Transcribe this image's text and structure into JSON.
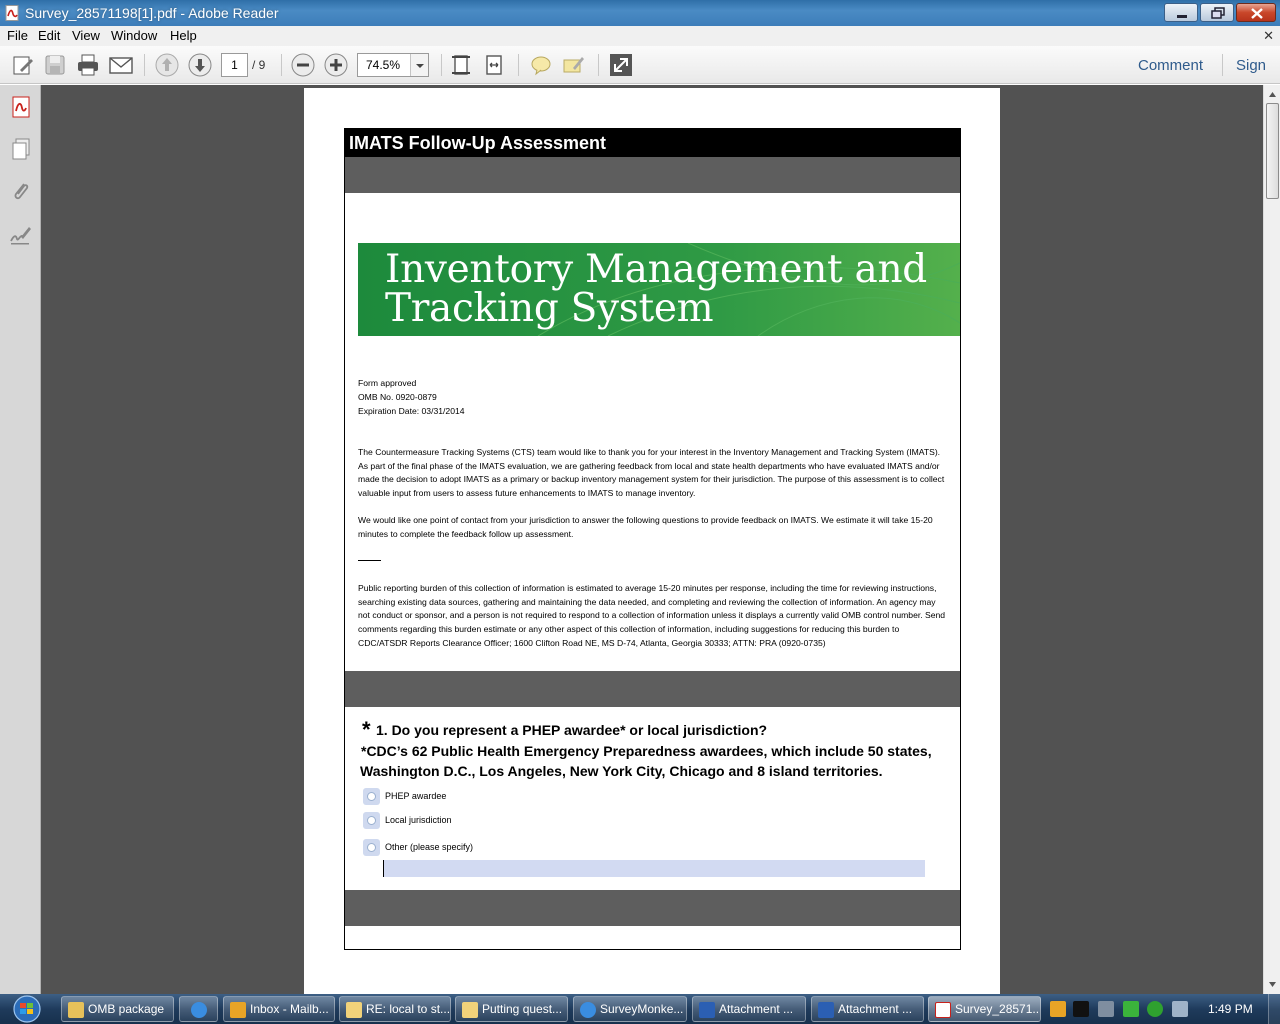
{
  "window": {
    "title": "Survey_28571198[1].pdf - Adobe Reader",
    "menu": [
      "File",
      "Edit",
      "View",
      "Window",
      "Help"
    ]
  },
  "toolbar": {
    "page_current": "1",
    "page_total": "/ 9",
    "zoom": "74.5%",
    "comment_label": "Comment",
    "sign_label": "Sign"
  },
  "document": {
    "form_title": "IMATS Follow-Up Assessment",
    "banner_line1": "Inventory Management and",
    "banner_line2": "Tracking System",
    "meta": [
      "Form approved",
      "OMB No. 0920-0879",
      "Expiration Date: 03/31/2014"
    ],
    "intro_p1": "The Countermeasure Tracking Systems (CTS) team would like to thank you for your interest in the Inventory Management and Tracking System (IMATS). As part of the final phase of the IMATS evaluation, we are gathering feedback from local and state health departments who have evaluated IMATS and/or made the decision to adopt IMATS as a primary or backup inventory management system for their jurisdiction. The purpose of this assessment is to collect valuable input from users to assess future enhancements to IMATS to manage inventory.",
    "intro_p2": "We would like one point of contact from your jurisdiction to answer the following questions to provide feedback on IMATS. We estimate it will take 15-20 minutes to complete the feedback follow up assessment.",
    "burden": "Public reporting burden of this collection of information is estimated to average 15-20 minutes per response, including the time for reviewing instructions, searching existing data sources, gathering and maintaining the data needed, and completing and reviewing the collection of information. An agency may not conduct or sponsor, and a person is not required to respond to a collection of information unless it displays a currently valid OMB control number. Send comments regarding this burden estimate or any other aspect of this collection of information, including suggestions for reducing this burden to CDC/ATSDR Reports Clearance Officer; 1600 Clifton Road NE, MS D-74, Atlanta, Georgia 30333; ATTN: PRA (0920-0735)",
    "question1": {
      "star": "*",
      "text": "1. Do you represent a PHEP awardee* or local jurisdiction?",
      "note1": "*CDC’s 62 Public Health Emergency Preparedness awardees, which include 50 states,",
      "note2": "Washington D.C., Los Angeles, New York City, Chicago and 8 island territories.",
      "options": [
        "PHEP awardee",
        "Local jurisdiction",
        "Other (please specify)"
      ]
    }
  },
  "taskbar": {
    "items": [
      "OMB package",
      "Inbox - Mailb...",
      "RE: local to st...",
      "Putting quest...",
      "SurveyMonke...",
      "Attachment ...",
      "Attachment ...",
      "Survey_28571..."
    ],
    "clock": "1:49 PM"
  },
  "colors": {
    "banner_green": "#2f9a45",
    "form_band_gray": "#5e5e5e",
    "doc_background": "#525252",
    "link_blue": "#2f5b8c"
  }
}
